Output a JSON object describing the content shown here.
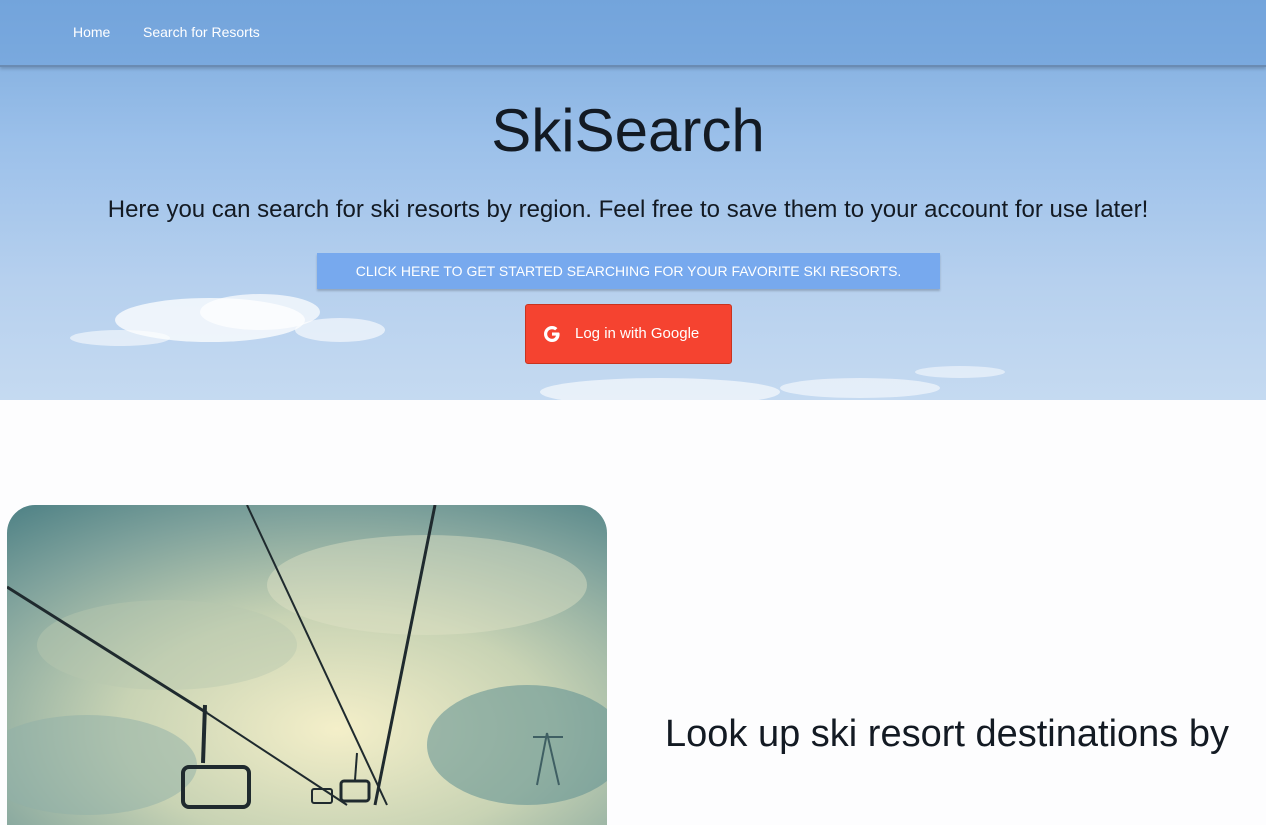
{
  "nav": {
    "home": "Home",
    "search": "Search for Resorts"
  },
  "hero": {
    "title": "SkiSearch",
    "subtitle": "Here you can search for ski resorts by region. Feel free to save them to your account for use later!",
    "start_button": "CLICK HERE TO GET STARTED SEARCHING FOR YOUR FAVORITE SKI RESORTS.",
    "google_button": "Log in with Google"
  },
  "feature": {
    "heading": "Look up ski resort destinations by"
  },
  "colors": {
    "start_button": "#77a9ee",
    "google_button": "#f54330",
    "text": "#131a23"
  },
  "icons": {
    "google": "google-g-icon"
  }
}
